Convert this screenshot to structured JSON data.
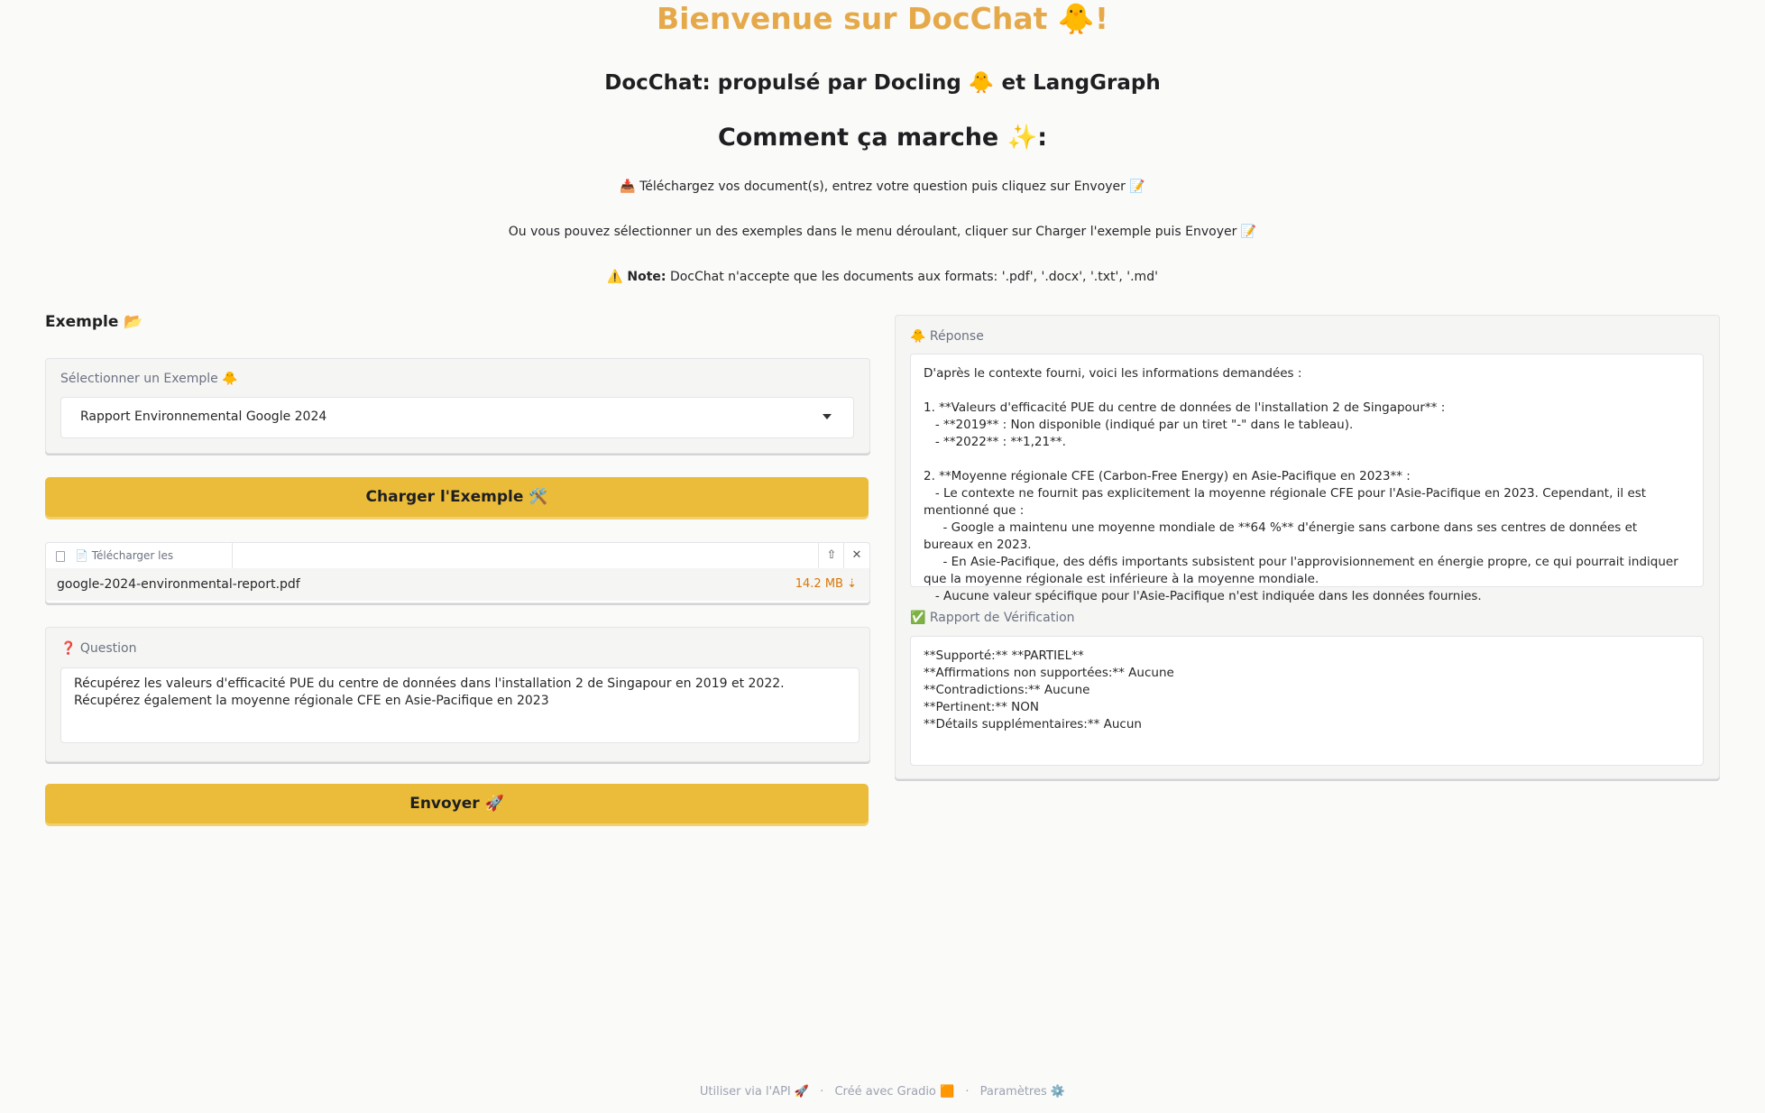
{
  "header": {
    "title": "Bienvenue sur DocChat 🐥!",
    "subtitle": "DocChat: propulsé par Docling 🐥 et LangGraph",
    "howto_title": "Comment ça marche ✨:",
    "line1": "📥 Téléchargez vos document(s), entrez votre question puis cliquez sur Envoyer 📝",
    "line2": "Ou vous pouvez sélectionner un des exemples dans le menu déroulant, cliquer sur Charger l'exemple puis Envoyer 📝",
    "note_prefix": "⚠️ Note:",
    "note_text": " DocChat n'accepte que les documents aux formats: '.pdf', '.docx', '.txt', '.md'"
  },
  "left": {
    "section_label": "Exemple 📂",
    "dropdown_label": "Sélectionner un Exemple 🐥",
    "dropdown_value": "Rapport Environnemental Google 2024",
    "load_button": "Charger l'Exemple 🛠️",
    "upload_label": "📄 Télécharger les Documents",
    "file_name": "google-2024-environmental-report.pdf",
    "file_size": "14.2 MB ⇣",
    "question_label": "❓ Question",
    "question_text": "Récupérez les valeurs d'efficacité PUE du centre de données dans l'installation 2 de Singapour en 2019 et 2022. Récupérez également la moyenne régionale CFE en Asie-Pacifique en 2023",
    "send_button": "Envoyer 🚀"
  },
  "right": {
    "response_label": "🐥 Réponse",
    "response_text": "D'après le contexte fourni, voici les informations demandées :\n\n1. **Valeurs d'efficacité PUE du centre de données de l'installation 2 de Singapour** :\n   - **2019** : Non disponible (indiqué par un tiret \"-\" dans le tableau).\n   - **2022** : **1,21**.\n\n2. **Moyenne régionale CFE (Carbon-Free Energy) en Asie-Pacifique en 2023** :\n   - Le contexte ne fournit pas explicitement la moyenne régionale CFE pour l'Asie-Pacifique en 2023. Cependant, il est mentionné que :\n     - Google a maintenu une moyenne mondiale de **64 %** d'énergie sans carbone dans ses centres de données et bureaux en 2023.\n     - En Asie-Pacifique, des défis importants subsistent pour l'approvisionnement en énergie propre, ce qui pourrait indiquer que la moyenne régionale est inférieure à la moyenne mondiale.\n   - Aucune valeur spécifique pour l'Asie-Pacifique n'est indiquée dans les données fournies.",
    "verification_label": "✅ Rapport de Vérification",
    "verification_text": "**Supporté:** **PARTIEL**\n**Affirmations non supportées:** Aucune\n**Contradictions:** Aucune\n**Pertinent:** NON\n**Détails supplémentaires:** Aucun"
  },
  "footer": {
    "api": "Utiliser via l'API 🚀",
    "built": "Créé avec Gradio 🟧",
    "settings": "Paramètres ⚙️",
    "separator": "·"
  },
  "colors": {
    "accent_button": "#eabc3a",
    "title": "#e5a94a",
    "file_size": "#d97706"
  }
}
